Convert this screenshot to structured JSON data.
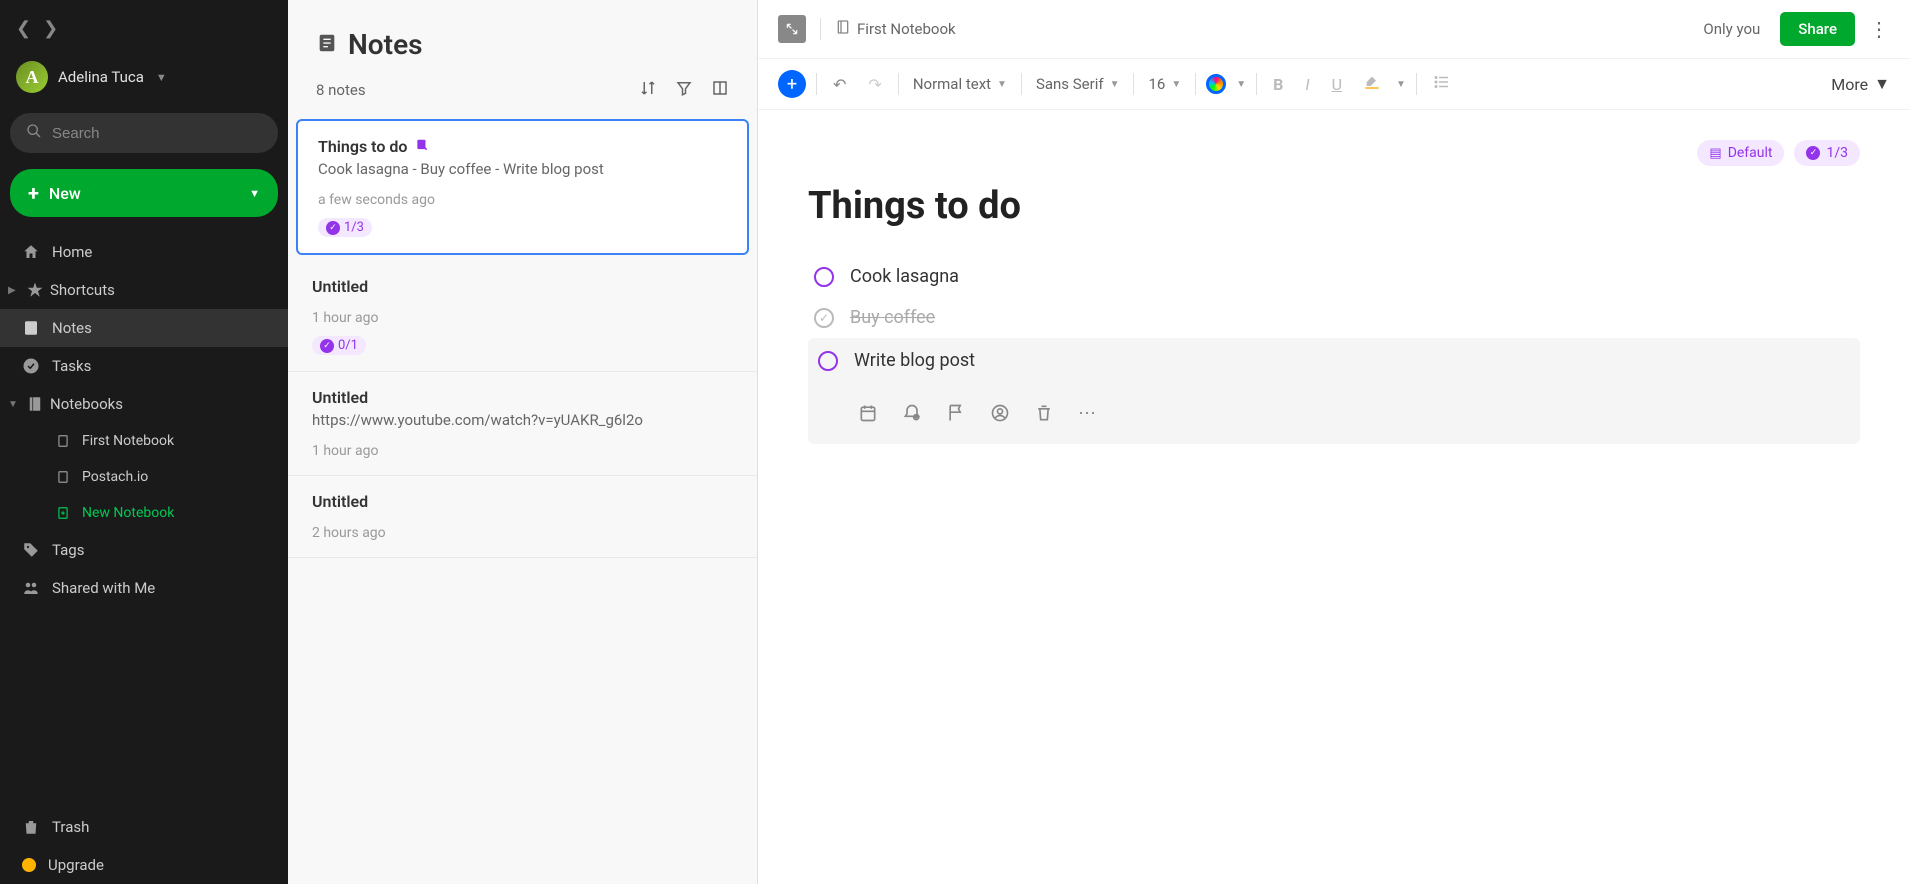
{
  "sidebar": {
    "user_name": "Adelina Tuca",
    "avatar_letter": "A",
    "search_placeholder": "Search",
    "new_label": "New",
    "nav": {
      "home": "Home",
      "shortcuts": "Shortcuts",
      "notes": "Notes",
      "tasks": "Tasks",
      "notebooks": "Notebooks",
      "tags": "Tags",
      "shared": "Shared with Me",
      "trash": "Trash",
      "upgrade": "Upgrade"
    },
    "notebooks": [
      "First Notebook",
      "Postach.io",
      "New Notebook"
    ]
  },
  "notes_pane": {
    "title": "Notes",
    "count": "8 notes",
    "items": [
      {
        "title": "Things to do",
        "preview": "Cook lasagna - Buy coffee - Write blog post",
        "time": "a few seconds ago",
        "badge": "1/3",
        "has_task": true
      },
      {
        "title": "Untitled",
        "preview": "",
        "time": "1 hour ago",
        "badge": "0/1",
        "has_task": false
      },
      {
        "title": "Untitled",
        "preview": "https://www.youtube.com/watch?v=yUAKR_g6l2o",
        "time": "1 hour ago",
        "badge": "",
        "has_task": false
      },
      {
        "title": "Untitled",
        "preview": "",
        "time": "2 hours ago",
        "badge": "",
        "has_task": false
      }
    ]
  },
  "editor": {
    "notebook": "First Notebook",
    "only_you": "Only you",
    "share": "Share",
    "toolbar": {
      "paragraph": "Normal text",
      "font": "Sans Serif",
      "size": "16",
      "more": "More"
    },
    "badges": {
      "default": "Default",
      "progress": "1/3"
    },
    "title": "Things to do",
    "tasks": [
      {
        "text": "Cook lasagna",
        "done": false
      },
      {
        "text": "Buy coffee",
        "done": true
      },
      {
        "text": "Write blog post",
        "done": false
      }
    ]
  }
}
